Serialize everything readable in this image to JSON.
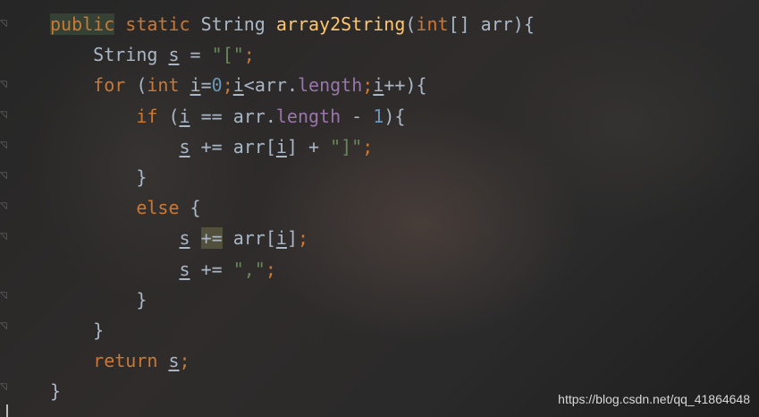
{
  "lines": [
    {
      "indent": "",
      "tokens": [
        {
          "t": "public",
          "c": "kw hl-word"
        },
        {
          "t": " ",
          "c": ""
        },
        {
          "t": "static",
          "c": "kw"
        },
        {
          "t": " String ",
          "c": ""
        },
        {
          "t": "array2String",
          "c": "fn"
        },
        {
          "t": "(",
          "c": ""
        },
        {
          "t": "int",
          "c": "kw"
        },
        {
          "t": "[] arr){",
          "c": ""
        }
      ]
    },
    {
      "indent": "    ",
      "tokens": [
        {
          "t": "String ",
          "c": ""
        },
        {
          "t": "s",
          "c": "var"
        },
        {
          "t": " = ",
          "c": ""
        },
        {
          "t": "\"[\"",
          "c": "str"
        },
        {
          "t": ";",
          "c": "kw"
        }
      ]
    },
    {
      "indent": "    ",
      "tokens": [
        {
          "t": "for",
          "c": "kw"
        },
        {
          "t": " (",
          "c": ""
        },
        {
          "t": "int",
          "c": "kw"
        },
        {
          "t": " ",
          "c": ""
        },
        {
          "t": "i",
          "c": "var"
        },
        {
          "t": "=",
          "c": ""
        },
        {
          "t": "0",
          "c": "num"
        },
        {
          "t": ";",
          "c": "kw"
        },
        {
          "t": "i",
          "c": "var"
        },
        {
          "t": "<arr.",
          "c": ""
        },
        {
          "t": "length",
          "c": "field"
        },
        {
          "t": ";",
          "c": "kw"
        },
        {
          "t": "i",
          "c": "var"
        },
        {
          "t": "++){",
          "c": ""
        }
      ]
    },
    {
      "indent": "        ",
      "tokens": [
        {
          "t": "if",
          "c": "kw"
        },
        {
          "t": " (",
          "c": ""
        },
        {
          "t": "i",
          "c": "var"
        },
        {
          "t": " == arr.",
          "c": ""
        },
        {
          "t": "length",
          "c": "field"
        },
        {
          "t": " - ",
          "c": ""
        },
        {
          "t": "1",
          "c": "num"
        },
        {
          "t": "){",
          "c": ""
        }
      ]
    },
    {
      "indent": "            ",
      "tokens": [
        {
          "t": "s",
          "c": "var"
        },
        {
          "t": " += arr[",
          "c": ""
        },
        {
          "t": "i",
          "c": "var"
        },
        {
          "t": "] + ",
          "c": ""
        },
        {
          "t": "\"]\"",
          "c": "str"
        },
        {
          "t": ";",
          "c": "kw"
        }
      ]
    },
    {
      "indent": "        ",
      "tokens": [
        {
          "t": "}",
          "c": ""
        }
      ]
    },
    {
      "indent": "        ",
      "tokens": [
        {
          "t": "else",
          "c": "kw"
        },
        {
          "t": " {",
          "c": ""
        }
      ]
    },
    {
      "indent": "            ",
      "tokens": [
        {
          "t": "s",
          "c": "var"
        },
        {
          "t": " ",
          "c": ""
        },
        {
          "t": "+=",
          "c": "hl-op"
        },
        {
          "t": " arr[",
          "c": ""
        },
        {
          "t": "i",
          "c": "var"
        },
        {
          "t": "]",
          "c": ""
        },
        {
          "t": ";",
          "c": "kw"
        }
      ]
    },
    {
      "indent": "            ",
      "tokens": [
        {
          "t": "s",
          "c": "var"
        },
        {
          "t": " += ",
          "c": ""
        },
        {
          "t": "\",\"",
          "c": "str"
        },
        {
          "t": ";",
          "c": "kw"
        }
      ]
    },
    {
      "indent": "        ",
      "tokens": [
        {
          "t": "}",
          "c": ""
        }
      ]
    },
    {
      "indent": "    ",
      "tokens": [
        {
          "t": "}",
          "c": ""
        }
      ]
    },
    {
      "indent": "    ",
      "tokens": [
        {
          "t": "return",
          "c": "kw"
        },
        {
          "t": " ",
          "c": ""
        },
        {
          "t": "s",
          "c": "var"
        },
        {
          "t": ";",
          "c": "kw"
        }
      ]
    },
    {
      "indent": "",
      "tokens": [
        {
          "t": "}",
          "c": ""
        }
      ]
    }
  ],
  "gutter": {
    "fold_icons": [
      "fold-icon",
      "fold-icon",
      "fold-icon",
      "fold-icon",
      "fold-icon",
      "fold-icon",
      "fold-icon",
      "fold-icon",
      "fold-icon",
      "fold-icon"
    ]
  },
  "watermark": "https://blog.csdn.net/qq_41864648",
  "colors": {
    "keyword": "#cc7832",
    "function": "#ffc66d",
    "string": "#6a8759",
    "number": "#6897bb",
    "field": "#9876aa",
    "default": "#a9b7c6"
  }
}
